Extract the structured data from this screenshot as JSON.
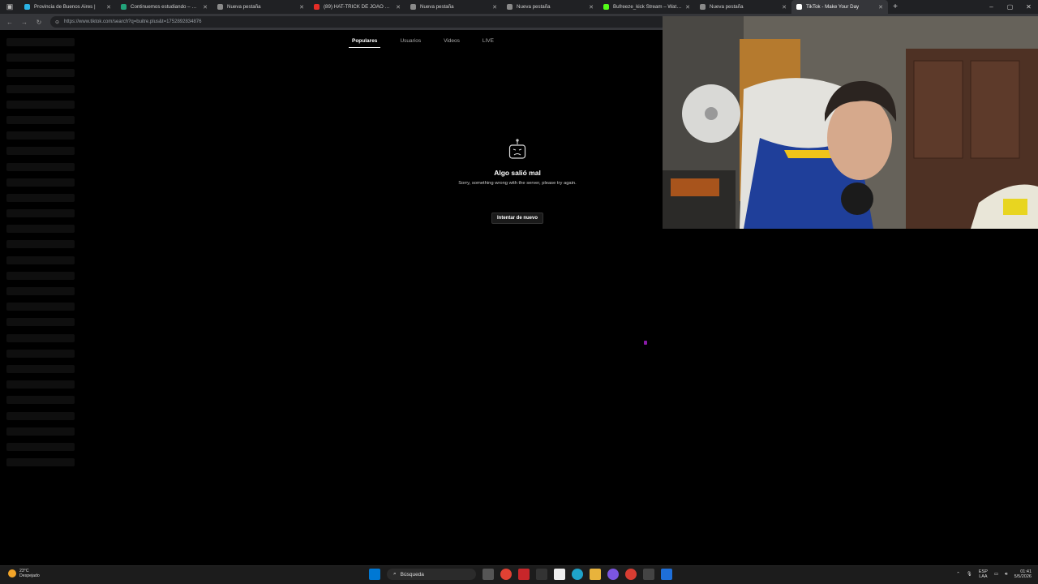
{
  "browser": {
    "tabs": [
      {
        "title": "Provincia de Buenos Aires |",
        "fav": "#2ab3e6",
        "active": false
      },
      {
        "title": "Continuemos estudiando – Plataf",
        "fav": "#22a37a",
        "active": false
      },
      {
        "title": "Nueva pestaña",
        "fav": "#8a8a8a",
        "active": false
      },
      {
        "title": "(89) HAT-TRICK DE JOAO PEDRO",
        "fav": "#e52d27",
        "active": false
      },
      {
        "title": "Nueva pestaña",
        "fav": "#8a8a8a",
        "active": false
      },
      {
        "title": "Nueva pestaña",
        "fav": "#8a8a8a",
        "active": false
      },
      {
        "title": "Bufreeze_kick Stream – Watch Liv",
        "fav": "#53fc18",
        "active": false
      },
      {
        "title": "Nueva pestaña",
        "fav": "#8a8a8a",
        "active": false
      },
      {
        "title": "TikTok - Make Your Day",
        "fav": "#ffffff",
        "active": true
      }
    ],
    "url": "https://www.tiktok.com/search?q=buitre.plus&t=1752892834876"
  },
  "search_tabs": [
    {
      "label": "Populares",
      "active": true
    },
    {
      "label": "Usuarios",
      "active": false
    },
    {
      "label": "Videos",
      "active": false
    },
    {
      "label": "LIVE",
      "active": false
    }
  ],
  "error": {
    "title": "Algo salió mal",
    "subtitle": "Sorry, something wrong with the server, please try again.",
    "retry_label": "Intentar de nuevo"
  },
  "taskbar": {
    "weather_temp": "23°C",
    "weather_desc": "Despejado",
    "search_label": "Búsqueda",
    "language": "ESP",
    "language_sub": "LAA",
    "time": "01:41",
    "date": "5/5/2026"
  },
  "colors": {
    "page_bg": "#000000",
    "tabstrip_bg": "#202124",
    "toolbar_bg": "#35363a",
    "taskbar_bg": "#1c1c1c"
  }
}
